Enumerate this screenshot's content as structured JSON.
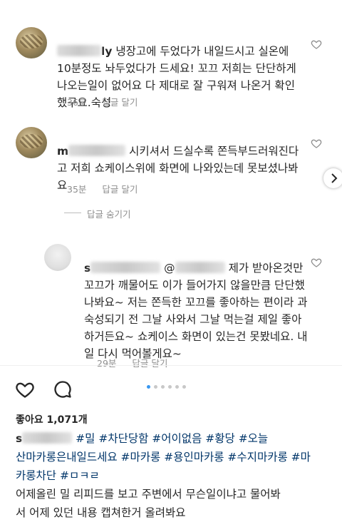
{
  "comments": [
    {
      "username_fragment": "ly",
      "text": "냉장고에 두었다가 내일드시고 실온에 10분정도 놔두었다가 드세요! 꼬끄 저희는 단단하게 나오는일이 없어요 다 제대로 잘 구워져 나온거 확인했구요.숙성",
      "time": "36분",
      "reply": "답글 달기"
    },
    {
      "username_fragment": "m",
      "text": "시키셔서 드실수록 쫀득부드러워진다고 저희 쇼케이스위에 화면에 나와있는데 못보셨나봐요",
      "time": "35분",
      "reply": "답글 달기"
    },
    {
      "username_fragment": "s",
      "mention_fragment": "@",
      "text": "제가 받아온것만 꼬끄가 깨물어도 이가 들어가지 않을만큼 단단했나봐요~ 저는 쫀득한 꼬끄를 좋아하는 편이라 과숙성되기 전 그날 사와서 그날 먹는걸 제일 좋아하거든요~ 쇼케이스 화면이 있는건 못봤네요. 내일 다시 먹어볼게요~",
      "time": "29분",
      "reply": "답글 달기"
    }
  ],
  "hide_replies": "답글 숨기기",
  "likes_label": "좋아요 1,071개",
  "caption": {
    "user_fragment": "s",
    "tags_line1": "#밀   #차단당함 #어이없음 #황당 #오늘",
    "tags_line2": "산마카롱은내일드세요 #마카롱 #용인마카롱 #수지마카롱 #마",
    "tags_line3": "카롱차단 #ㅁㅋㄹ",
    "body_line1": "어제올린 밀   리피드를 보고 주변에서 무슨일이냐고 물어봐",
    "body_line2": "서 어제 있던 내용 캡쳐한거 올려봐요"
  },
  "icons": [
    "heart-icon",
    "comment-icon",
    "next-arrow-icon"
  ]
}
